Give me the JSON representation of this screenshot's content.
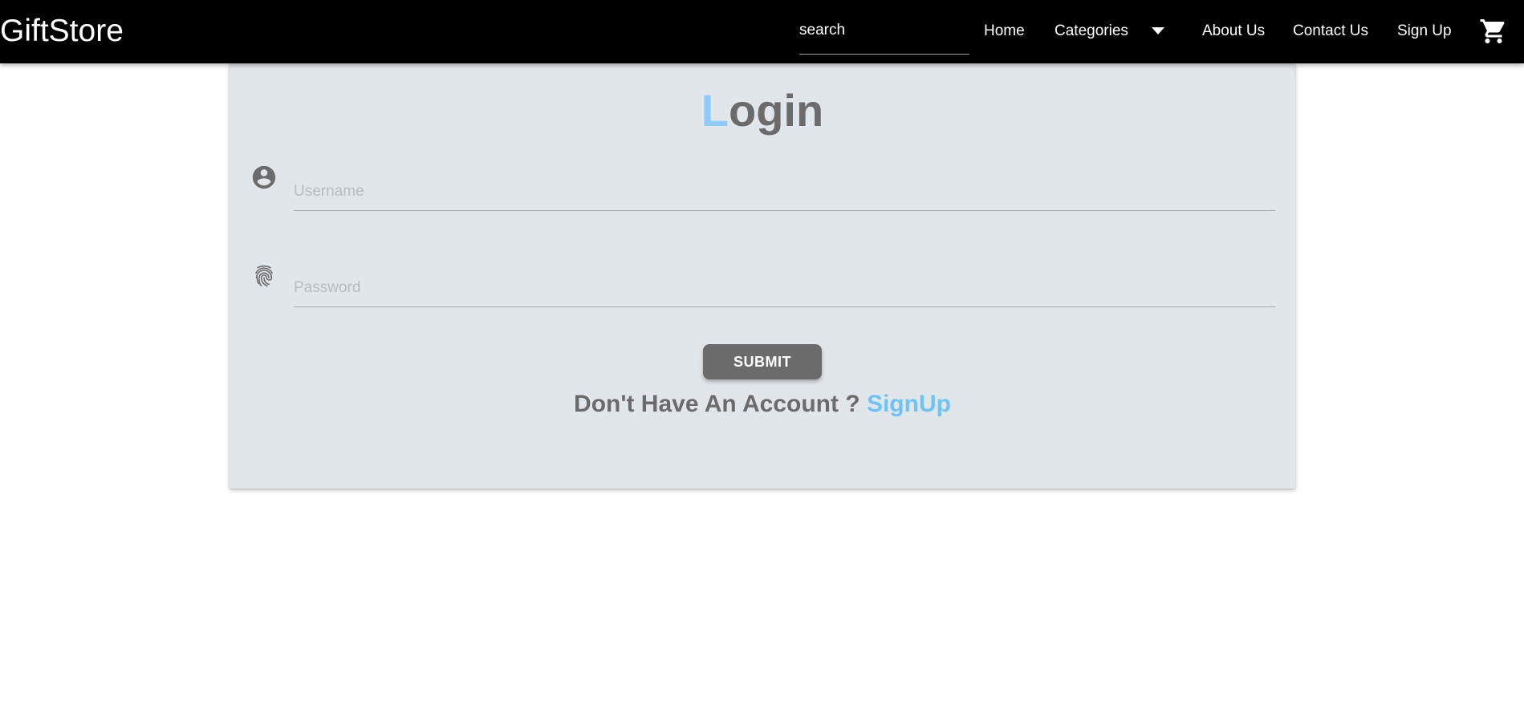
{
  "navbar": {
    "brand": "GiftStore",
    "search_placeholder": "search",
    "links": {
      "home": "Home",
      "categories": "Categories",
      "about": "About Us",
      "contact": "Contact Us",
      "signup": "Sign Up"
    },
    "icons": {
      "categories_caret": "arrow-drop-down-icon",
      "cart": "shopping-cart-icon"
    }
  },
  "login": {
    "title_first_letter": "L",
    "title_rest": "ogin",
    "username_placeholder": "Username",
    "password_placeholder": "Password",
    "submit_label": "SUBMIT",
    "account_prompt": "Don't Have An Account ? ",
    "signup_link": "SignUp",
    "icons": {
      "username": "account-circle-icon",
      "password": "fingerprint-icon"
    }
  },
  "colors": {
    "navbar_bg": "#000000",
    "card_bg": "#e1e6ea",
    "title_accent": "#90caf9",
    "link_accent": "#6ec3f4",
    "button_bg": "#6b6b6b",
    "text_gray": "#6b6b6b"
  }
}
